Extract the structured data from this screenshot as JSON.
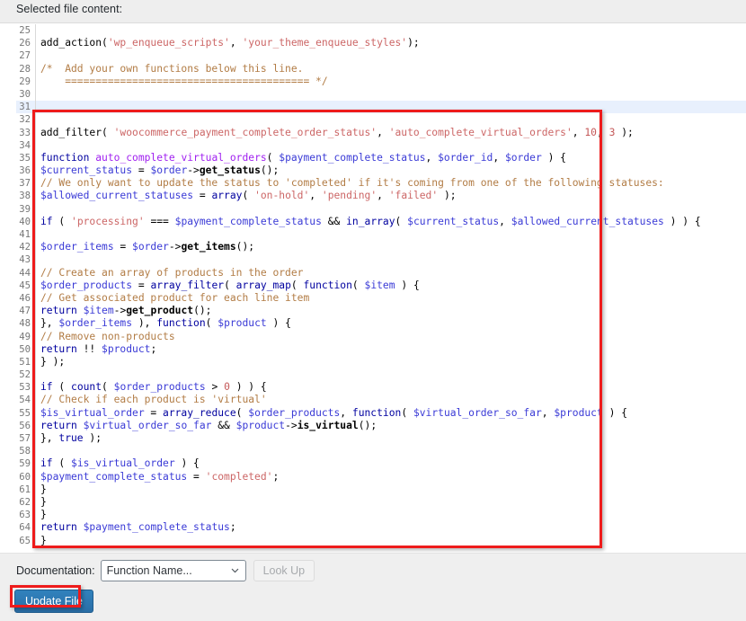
{
  "header": {
    "title": "Selected file content:"
  },
  "editor": {
    "highlighted_line": 31,
    "first_visible_line": 25,
    "lines": [
      {
        "n": "25",
        "tokens": []
      },
      {
        "n": "26",
        "tokens": [
          {
            "t": "add_action",
            "c": "op"
          },
          {
            "t": "(",
            "c": "op"
          },
          {
            "t": "'wp_enqueue_scripts'",
            "c": "str"
          },
          {
            "t": ", ",
            "c": "op"
          },
          {
            "t": "'your_theme_enqueue_styles'",
            "c": "str"
          },
          {
            "t": ");",
            "c": "op"
          }
        ]
      },
      {
        "n": "27",
        "tokens": []
      },
      {
        "n": "28",
        "tokens": [
          {
            "t": "/*  Add your own functions below this line.",
            "c": "cm"
          }
        ]
      },
      {
        "n": "29",
        "tokens": [
          {
            "t": "    ======================================== */",
            "c": "cm"
          }
        ]
      },
      {
        "n": "30",
        "tokens": []
      },
      {
        "n": "31",
        "tokens": []
      },
      {
        "n": "32",
        "tokens": []
      },
      {
        "n": "33",
        "tokens": [
          {
            "t": "add_filter",
            "c": "op"
          },
          {
            "t": "( ",
            "c": "op"
          },
          {
            "t": "'woocommerce_payment_complete_order_status'",
            "c": "str"
          },
          {
            "t": ", ",
            "c": "op"
          },
          {
            "t": "'auto_complete_virtual_orders'",
            "c": "str"
          },
          {
            "t": ", ",
            "c": "op"
          },
          {
            "t": "10",
            "c": "num"
          },
          {
            "t": ", ",
            "c": "op"
          },
          {
            "t": "3",
            "c": "num"
          },
          {
            "t": " );",
            "c": "op"
          }
        ]
      },
      {
        "n": "34",
        "tokens": []
      },
      {
        "n": "35",
        "tokens": [
          {
            "t": "function",
            "c": "k"
          },
          {
            "t": " ",
            "c": "op"
          },
          {
            "t": "auto_complete_virtual_orders",
            "c": "fn"
          },
          {
            "t": "( ",
            "c": "op"
          },
          {
            "t": "$payment_complete_status",
            "c": "var"
          },
          {
            "t": ", ",
            "c": "op"
          },
          {
            "t": "$order_id",
            "c": "var"
          },
          {
            "t": ", ",
            "c": "op"
          },
          {
            "t": "$order",
            "c": "var"
          },
          {
            "t": " ) {",
            "c": "op"
          }
        ]
      },
      {
        "n": "36",
        "tokens": [
          {
            "t": "$current_status",
            "c": "var"
          },
          {
            "t": " = ",
            "c": "op"
          },
          {
            "t": "$order",
            "c": "var"
          },
          {
            "t": "->",
            "c": "op"
          },
          {
            "t": "get_status",
            "c": "mth"
          },
          {
            "t": "();",
            "c": "op"
          }
        ]
      },
      {
        "n": "37",
        "tokens": [
          {
            "t": "// We only want to update the status to 'completed' if it's coming from one of the following statuses:",
            "c": "cm"
          }
        ]
      },
      {
        "n": "38",
        "tokens": [
          {
            "t": "$allowed_current_statuses",
            "c": "var"
          },
          {
            "t": " = ",
            "c": "op"
          },
          {
            "t": "array",
            "c": "k"
          },
          {
            "t": "( ",
            "c": "op"
          },
          {
            "t": "'on-hold'",
            "c": "str"
          },
          {
            "t": ", ",
            "c": "op"
          },
          {
            "t": "'pending'",
            "c": "str"
          },
          {
            "t": ", ",
            "c": "op"
          },
          {
            "t": "'failed'",
            "c": "str"
          },
          {
            "t": " );",
            "c": "op"
          }
        ]
      },
      {
        "n": "39",
        "tokens": []
      },
      {
        "n": "40",
        "tokens": [
          {
            "t": "if",
            "c": "k"
          },
          {
            "t": " ( ",
            "c": "op"
          },
          {
            "t": "'processing'",
            "c": "str"
          },
          {
            "t": " === ",
            "c": "op"
          },
          {
            "t": "$payment_complete_status",
            "c": "var"
          },
          {
            "t": " && ",
            "c": "op"
          },
          {
            "t": "in_array",
            "c": "k"
          },
          {
            "t": "( ",
            "c": "op"
          },
          {
            "t": "$current_status",
            "c": "var"
          },
          {
            "t": ", ",
            "c": "op"
          },
          {
            "t": "$allowed_current_statuses",
            "c": "var"
          },
          {
            "t": " ) ) {",
            "c": "op"
          }
        ]
      },
      {
        "n": "41",
        "tokens": []
      },
      {
        "n": "42",
        "tokens": [
          {
            "t": "$order_items",
            "c": "var"
          },
          {
            "t": " = ",
            "c": "op"
          },
          {
            "t": "$order",
            "c": "var"
          },
          {
            "t": "->",
            "c": "op"
          },
          {
            "t": "get_items",
            "c": "mth"
          },
          {
            "t": "();",
            "c": "op"
          }
        ]
      },
      {
        "n": "43",
        "tokens": []
      },
      {
        "n": "44",
        "tokens": [
          {
            "t": "// Create an array of products in the order",
            "c": "cm"
          }
        ]
      },
      {
        "n": "45",
        "tokens": [
          {
            "t": "$order_products",
            "c": "var"
          },
          {
            "t": " = ",
            "c": "op"
          },
          {
            "t": "array_filter",
            "c": "k"
          },
          {
            "t": "( ",
            "c": "op"
          },
          {
            "t": "array_map",
            "c": "k"
          },
          {
            "t": "( ",
            "c": "op"
          },
          {
            "t": "function",
            "c": "k"
          },
          {
            "t": "( ",
            "c": "op"
          },
          {
            "t": "$item",
            "c": "var"
          },
          {
            "t": " ) {",
            "c": "op"
          }
        ]
      },
      {
        "n": "46",
        "tokens": [
          {
            "t": "// Get associated product for each line item",
            "c": "cm"
          }
        ]
      },
      {
        "n": "47",
        "tokens": [
          {
            "t": "return",
            "c": "k"
          },
          {
            "t": " ",
            "c": "op"
          },
          {
            "t": "$item",
            "c": "var"
          },
          {
            "t": "->",
            "c": "op"
          },
          {
            "t": "get_product",
            "c": "mth"
          },
          {
            "t": "();",
            "c": "op"
          }
        ]
      },
      {
        "n": "48",
        "tokens": [
          {
            "t": "}, ",
            "c": "op"
          },
          {
            "t": "$order_items",
            "c": "var"
          },
          {
            "t": " ), ",
            "c": "op"
          },
          {
            "t": "function",
            "c": "k"
          },
          {
            "t": "( ",
            "c": "op"
          },
          {
            "t": "$product",
            "c": "var"
          },
          {
            "t": " ) {",
            "c": "op"
          }
        ]
      },
      {
        "n": "49",
        "tokens": [
          {
            "t": "// Remove non-products",
            "c": "cm"
          }
        ]
      },
      {
        "n": "50",
        "tokens": [
          {
            "t": "return",
            "c": "k"
          },
          {
            "t": " !! ",
            "c": "op"
          },
          {
            "t": "$product",
            "c": "var"
          },
          {
            "t": ";",
            "c": "op"
          }
        ]
      },
      {
        "n": "51",
        "tokens": [
          {
            "t": "} );",
            "c": "op"
          }
        ]
      },
      {
        "n": "52",
        "tokens": []
      },
      {
        "n": "53",
        "tokens": [
          {
            "t": "if",
            "c": "k"
          },
          {
            "t": " ( ",
            "c": "op"
          },
          {
            "t": "count",
            "c": "k"
          },
          {
            "t": "( ",
            "c": "op"
          },
          {
            "t": "$order_products",
            "c": "var"
          },
          {
            "t": " > ",
            "c": "op"
          },
          {
            "t": "0",
            "c": "num"
          },
          {
            "t": " ) ) {",
            "c": "op"
          }
        ]
      },
      {
        "n": "54",
        "tokens": [
          {
            "t": "// Check if each product is 'virtual'",
            "c": "cm"
          }
        ]
      },
      {
        "n": "55",
        "tokens": [
          {
            "t": "$is_virtual_order",
            "c": "var"
          },
          {
            "t": " = ",
            "c": "op"
          },
          {
            "t": "array_reduce",
            "c": "k"
          },
          {
            "t": "( ",
            "c": "op"
          },
          {
            "t": "$order_products",
            "c": "var"
          },
          {
            "t": ", ",
            "c": "op"
          },
          {
            "t": "function",
            "c": "k"
          },
          {
            "t": "( ",
            "c": "op"
          },
          {
            "t": "$virtual_order_so_far",
            "c": "var"
          },
          {
            "t": ", ",
            "c": "op"
          },
          {
            "t": "$product",
            "c": "var"
          },
          {
            "t": " ) {",
            "c": "op"
          }
        ]
      },
      {
        "n": "56",
        "tokens": [
          {
            "t": "return",
            "c": "k"
          },
          {
            "t": " ",
            "c": "op"
          },
          {
            "t": "$virtual_order_so_far",
            "c": "var"
          },
          {
            "t": " && ",
            "c": "op"
          },
          {
            "t": "$product",
            "c": "var"
          },
          {
            "t": "->",
            "c": "op"
          },
          {
            "t": "is_virtual",
            "c": "mth"
          },
          {
            "t": "();",
            "c": "op"
          }
        ]
      },
      {
        "n": "57",
        "tokens": [
          {
            "t": "}, ",
            "c": "op"
          },
          {
            "t": "true",
            "c": "k"
          },
          {
            "t": " );",
            "c": "op"
          }
        ]
      },
      {
        "n": "58",
        "tokens": []
      },
      {
        "n": "59",
        "tokens": [
          {
            "t": "if",
            "c": "k"
          },
          {
            "t": " ( ",
            "c": "op"
          },
          {
            "t": "$is_virtual_order",
            "c": "var"
          },
          {
            "t": " ) {",
            "c": "op"
          }
        ]
      },
      {
        "n": "60",
        "tokens": [
          {
            "t": "$payment_complete_status",
            "c": "var"
          },
          {
            "t": " = ",
            "c": "op"
          },
          {
            "t": "'completed'",
            "c": "str"
          },
          {
            "t": ";",
            "c": "op"
          }
        ]
      },
      {
        "n": "61",
        "tokens": [
          {
            "t": "}",
            "c": "op"
          }
        ]
      },
      {
        "n": "62",
        "tokens": [
          {
            "t": "}",
            "c": "op"
          }
        ]
      },
      {
        "n": "63",
        "tokens": [
          {
            "t": "}",
            "c": "op"
          }
        ]
      },
      {
        "n": "64",
        "tokens": [
          {
            "t": "return",
            "c": "k"
          },
          {
            "t": " ",
            "c": "op"
          },
          {
            "t": "$payment_complete_status",
            "c": "var"
          },
          {
            "t": ";",
            "c": "op"
          }
        ]
      },
      {
        "n": "65",
        "tokens": [
          {
            "t": "}",
            "c": "op"
          }
        ]
      }
    ]
  },
  "footer": {
    "documentation_label": "Documentation:",
    "select_value": "Function Name...",
    "lookup_label": "Look Up",
    "update_label": "Update File"
  },
  "annotations": {
    "code_box_color": "#ee1b1b",
    "button_box_color": "#ee1b1b"
  }
}
